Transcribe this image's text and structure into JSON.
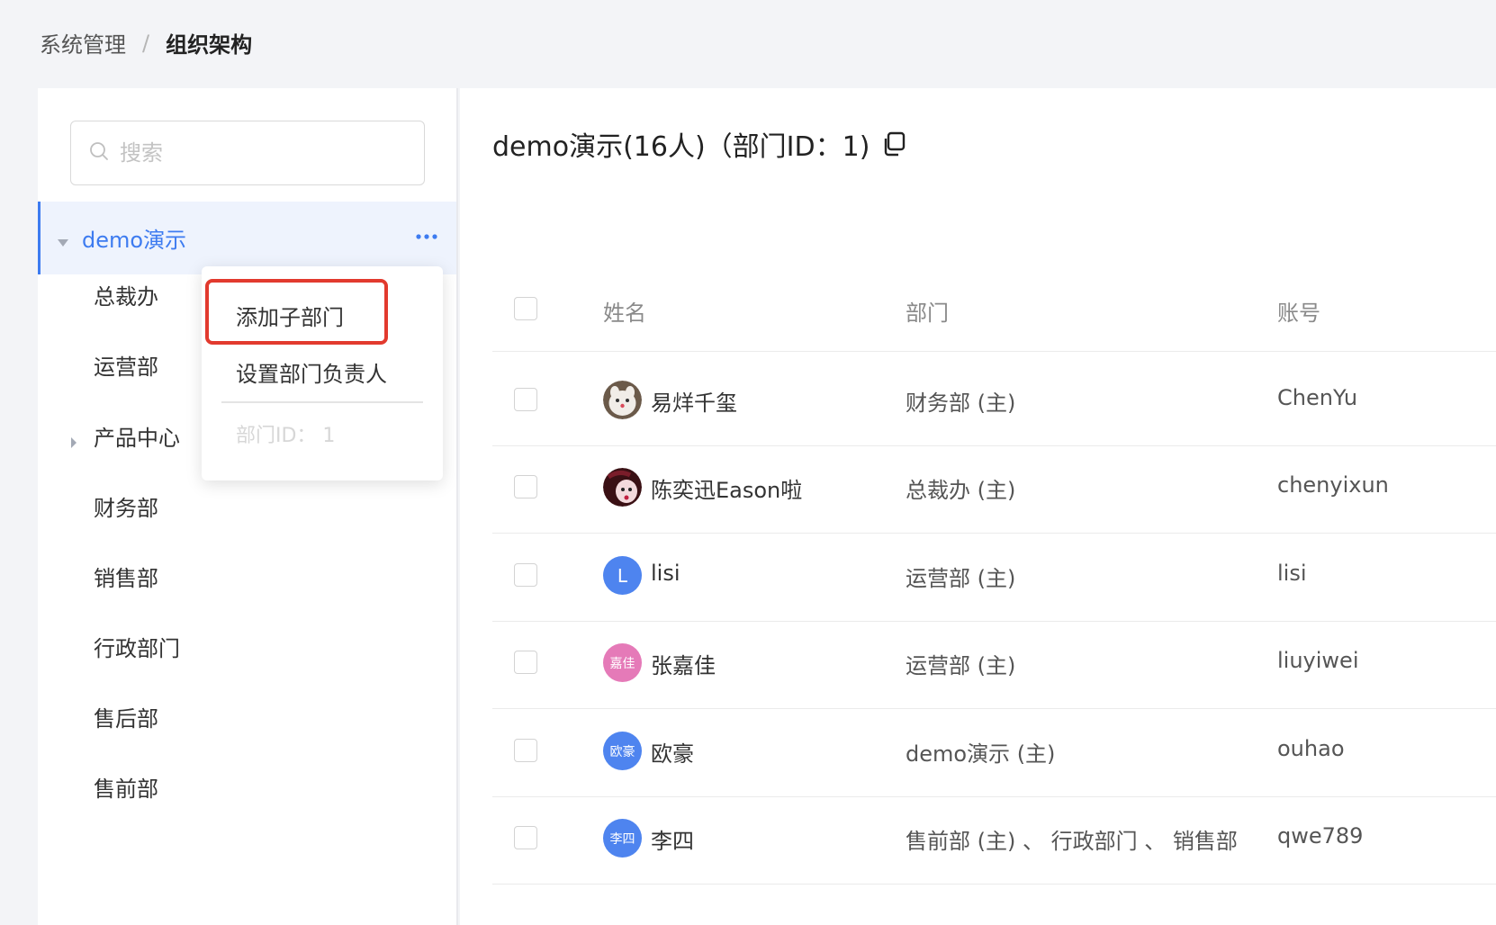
{
  "breadcrumb": {
    "parent": "系统管理",
    "separator": "/",
    "current": "组织架构"
  },
  "search": {
    "placeholder": "搜索"
  },
  "tree": {
    "root_label": "demo演示",
    "items": [
      {
        "label": "总裁办"
      },
      {
        "label": "运营部"
      },
      {
        "label": "产品中心",
        "expandable": true
      },
      {
        "label": "财务部"
      },
      {
        "label": "销售部"
      },
      {
        "label": "行政部门"
      },
      {
        "label": "售后部"
      },
      {
        "label": "售前部"
      }
    ]
  },
  "popover": {
    "add_sub_dept": "添加子部门",
    "set_dept_head": "设置部门负责人",
    "dept_id": "部门ID： 1"
  },
  "main": {
    "title": "demo演示(16人)（部门ID：1)"
  },
  "table": {
    "headers": {
      "name": "姓名",
      "dept": "部门",
      "account": "账号"
    },
    "rows": [
      {
        "name": "易烊千玺",
        "dept": "财务部 (主)",
        "account": "ChenYu",
        "avatar_text": "",
        "avatar_kind": "photo-cat"
      },
      {
        "name": "陈奕迅Eason啦",
        "dept": "总裁办 (主)",
        "account": "chenyixun",
        "avatar_text": "",
        "avatar_kind": "photo-dark"
      },
      {
        "name": "lisi",
        "dept": "运营部 (主)",
        "account": "lisi",
        "avatar_text": "L",
        "avatar_kind": "blue"
      },
      {
        "name": "张嘉佳",
        "dept": "运营部 (主)",
        "account": "liuyiwei",
        "avatar_text": "嘉佳",
        "avatar_kind": "pink"
      },
      {
        "name": "欧豪",
        "dept": "demo演示 (主)",
        "account": "ouhao",
        "avatar_text": "欧豪",
        "avatar_kind": "blue"
      },
      {
        "name": "李四",
        "dept": "售前部 (主) 、 行政部门 、 销售部",
        "account": "qwe789",
        "avatar_text": "李四",
        "avatar_kind": "blue"
      }
    ]
  },
  "colors": {
    "accent": "#3d7bf0",
    "highlight": "#e23a2e",
    "avatar_blue": "#4e84ef",
    "avatar_pink": "#e57ab8"
  }
}
